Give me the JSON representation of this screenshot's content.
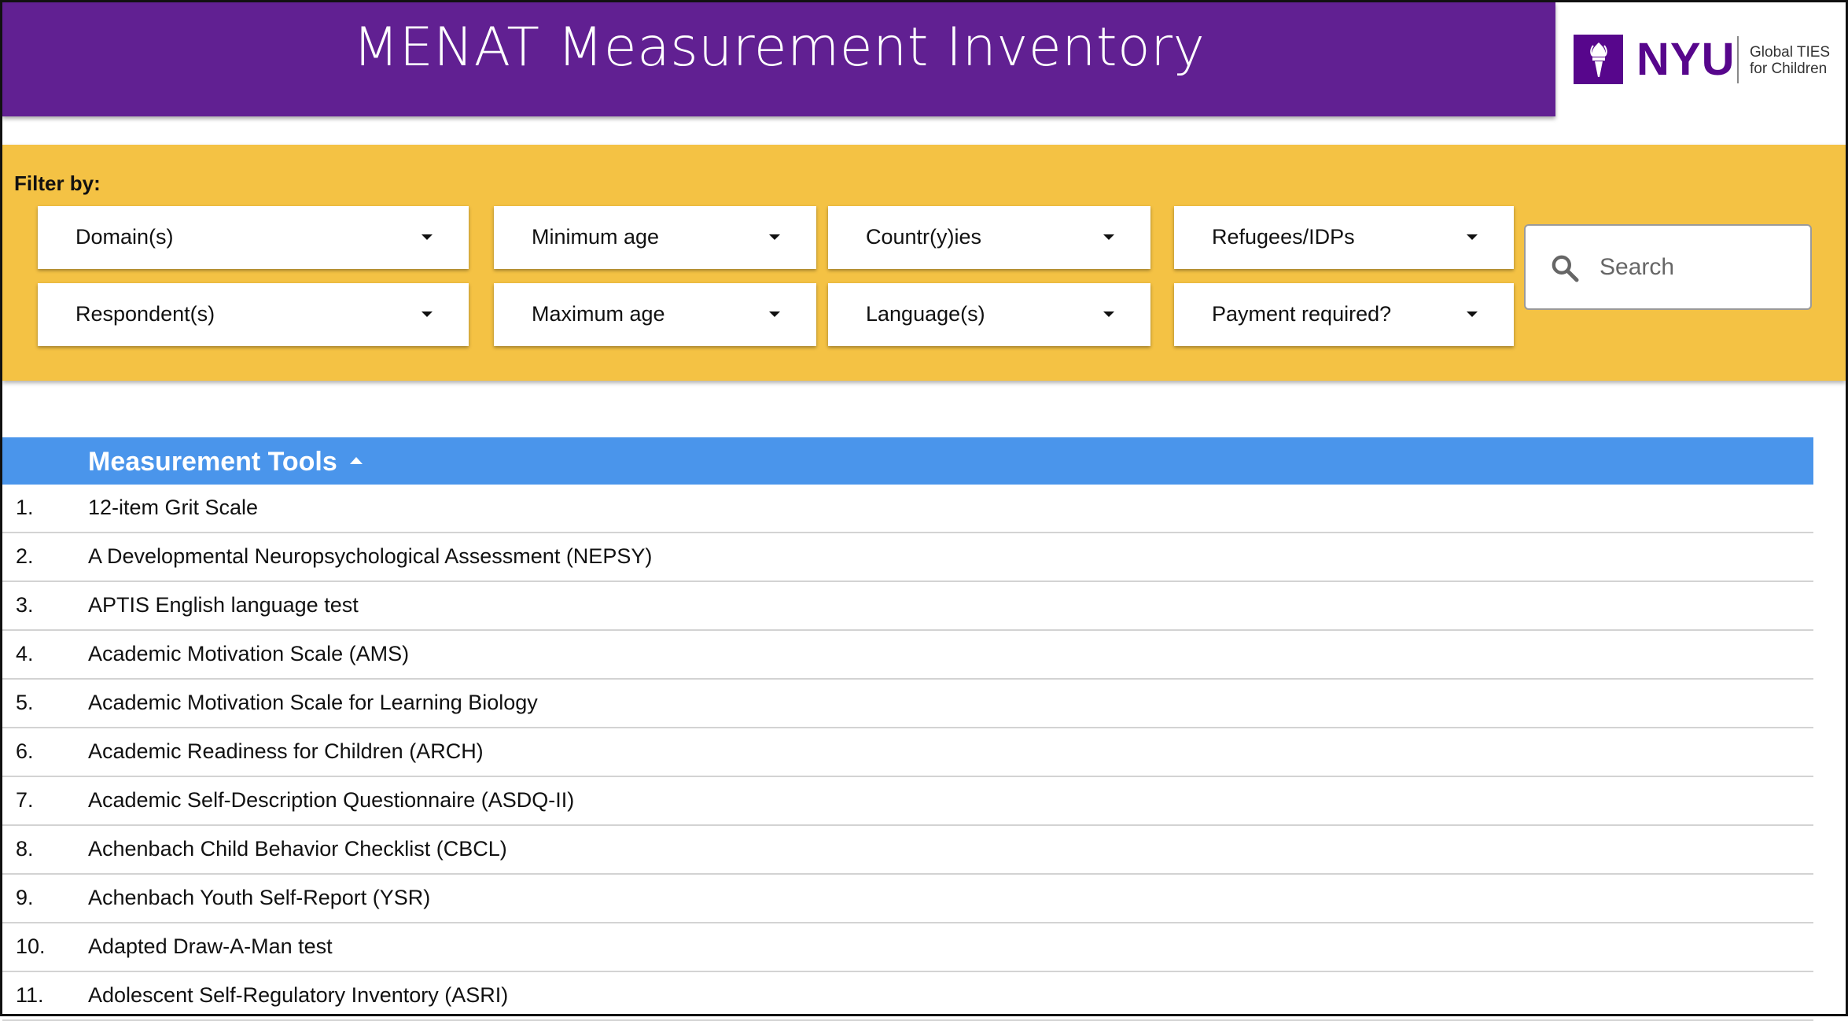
{
  "header": {
    "title": "MENAT Measurement Inventory",
    "logo": {
      "brand": "NYU",
      "line1": "Global TIES",
      "line2": "for Children",
      "icon": "torch-icon"
    },
    "colors": {
      "header_bg": "#612092",
      "filter_bg": "#f4c244",
      "table_header_bg": "#4a95eb"
    }
  },
  "filters": {
    "label": "Filter by:",
    "dropdowns": [
      {
        "id": "domains",
        "label": "Domain(s)"
      },
      {
        "id": "min-age",
        "label": "Minimum age"
      },
      {
        "id": "countries",
        "label": "Countr(y)ies"
      },
      {
        "id": "refugees",
        "label": "Refugees/IDPs"
      },
      {
        "id": "respondents",
        "label": "Respondent(s)"
      },
      {
        "id": "max-age",
        "label": "Maximum age"
      },
      {
        "id": "languages",
        "label": "Language(s)"
      },
      {
        "id": "payment",
        "label": "Payment required?"
      }
    ],
    "search": {
      "placeholder": "Search",
      "value": ""
    }
  },
  "table": {
    "column_header": "Measurement Tools",
    "sort": "ascending",
    "rows": [
      {
        "num": "1.",
        "name": "12-item Grit Scale"
      },
      {
        "num": "2.",
        "name": "A Developmental Neuropsychological Assessment (NEPSY)"
      },
      {
        "num": "3.",
        "name": "APTIS English language test"
      },
      {
        "num": "4.",
        "name": "Academic Motivation Scale (AMS)"
      },
      {
        "num": "5.",
        "name": "Academic Motivation Scale for Learning Biology"
      },
      {
        "num": "6.",
        "name": "Academic Readiness for Children (ARCH)"
      },
      {
        "num": "7.",
        "name": "Academic Self-Description Questionnaire (ASDQ-II)"
      },
      {
        "num": "8.",
        "name": "Achenbach Child Behavior Checklist (CBCL)"
      },
      {
        "num": "9.",
        "name": "Achenbach Youth Self-Report (YSR)"
      },
      {
        "num": "10.",
        "name": "Adapted Draw-A-Man test"
      },
      {
        "num": "11.",
        "name": "Adolescent Self-Regulatory Inventory (ASRI)"
      }
    ]
  }
}
